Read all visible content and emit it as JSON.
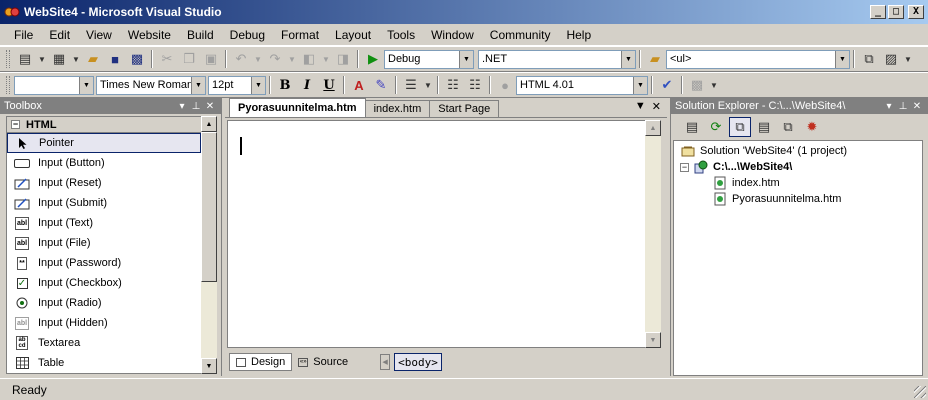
{
  "window": {
    "title": "WebSite4 - Microsoft Visual Studio",
    "minimize": "_",
    "maximize": "□",
    "close": "X"
  },
  "menu": [
    "File",
    "Edit",
    "View",
    "Website",
    "Build",
    "Debug",
    "Format",
    "Layout",
    "Tools",
    "Window",
    "Community",
    "Help"
  ],
  "toolbar1": {
    "config": "Debug",
    "platform": ".NET",
    "element": "<ul>"
  },
  "toolbar2": {
    "font_name": "Times New Roman",
    "font_size": "12pt",
    "bold": "B",
    "italic": "I",
    "underline": "U",
    "doctype": "HTML 4.01"
  },
  "toolbox": {
    "title": "Toolbox",
    "group": "HTML",
    "items": [
      {
        "label": "Pointer",
        "icon": "pointer-icon"
      },
      {
        "label": "Input (Button)",
        "icon": "button-icon"
      },
      {
        "label": "Input (Reset)",
        "icon": "reset-icon"
      },
      {
        "label": "Input (Submit)",
        "icon": "submit-icon"
      },
      {
        "label": "Input (Text)",
        "icon": "textbox-icon"
      },
      {
        "label": "Input (File)",
        "icon": "file-input-icon"
      },
      {
        "label": "Input (Password)",
        "icon": "password-icon"
      },
      {
        "label": "Input (Checkbox)",
        "icon": "checkbox-icon"
      },
      {
        "label": "Input (Radio)",
        "icon": "radio-icon"
      },
      {
        "label": "Input (Hidden)",
        "icon": "hidden-input-icon"
      },
      {
        "label": "Textarea",
        "icon": "textarea-icon"
      },
      {
        "label": "Table",
        "icon": "table-icon"
      }
    ]
  },
  "editor": {
    "tabs": [
      "Pyorasuunnitelma.htm",
      "index.htm",
      "Start Page"
    ],
    "views": [
      "Design",
      "Source"
    ],
    "tag": "<body>"
  },
  "solution_explorer": {
    "title": "Solution Explorer - C:\\...\\WebSite4\\",
    "solution": "Solution 'WebSite4' (1 project)",
    "project": "C:\\...\\WebSite4\\",
    "files": [
      "index.htm",
      "Pyorasuunnitelma.htm"
    ]
  },
  "status": "Ready"
}
